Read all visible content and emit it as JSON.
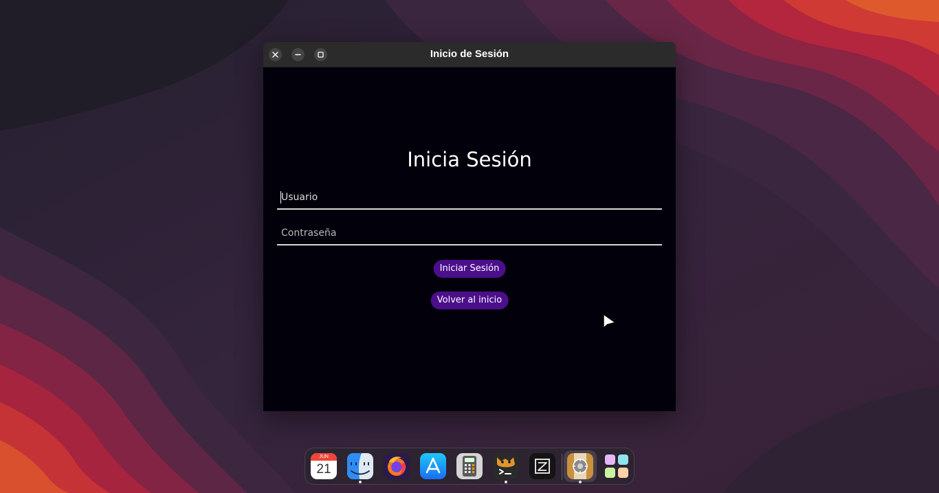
{
  "window": {
    "title": "Inicio de Sesión"
  },
  "form": {
    "heading": "Inicia Sesión",
    "username_placeholder": "Usuario",
    "password_placeholder": "Contraseña",
    "login_button": "Iniciar Sesión",
    "back_button": "Volver al inicio"
  },
  "dock": {
    "calendar": {
      "month": "JUN",
      "day": "21"
    }
  },
  "colors": {
    "window_bg": "#01000b",
    "titlebar_bg": "#2b2b2b",
    "button_accent": "#4b0f8c"
  }
}
